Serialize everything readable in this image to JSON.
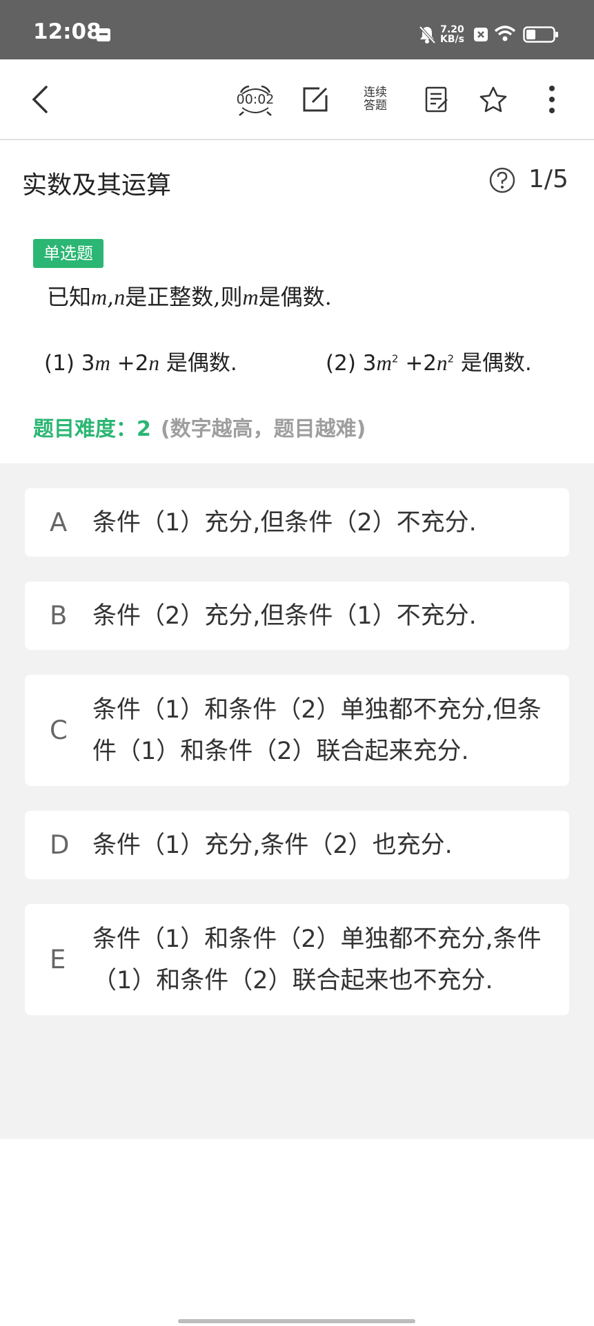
{
  "status_bar": {
    "time": "12:08",
    "net_speed_value": "7.20",
    "net_speed_unit": "KB/s",
    "icons": [
      "calendar-icon",
      "bell-muted-icon",
      "x-box-icon",
      "wifi-icon",
      "battery-icon"
    ]
  },
  "toolbar": {
    "timer": "00:02",
    "continuous_line1": "连续",
    "continuous_line2": "答题",
    "icons": [
      "back-icon",
      "timer-icon",
      "edit-icon",
      "answer-sheet-icon",
      "star-icon",
      "more-icon"
    ]
  },
  "header": {
    "title": "实数及其运算",
    "counter": "1/5"
  },
  "question": {
    "type_badge": "单选题",
    "stem_parts": [
      "已知",
      "m",
      ",",
      "n",
      "是正整数,则",
      "m",
      "是偶数."
    ],
    "condition1": {
      "label": "(1)",
      "coef1": "3",
      "var1": "m",
      "op": "+2",
      "var2": "n",
      "tail": "是偶数."
    },
    "condition2": {
      "label": "(2)",
      "coef1": "3",
      "var1": "m",
      "exp1": "2",
      "op": "+2",
      "var2": "n",
      "exp2": "2",
      "tail": "是偶数."
    },
    "difficulty_label": "题目难度：2",
    "difficulty_hint": "(数字越高，题目越难)"
  },
  "options": [
    {
      "letter": "A",
      "text": "条件（1）充分,但条件（2）不充分."
    },
    {
      "letter": "B",
      "text": "条件（2）充分,但条件（1）不充分."
    },
    {
      "letter": "C",
      "text": "条件（1）和条件（2）单独都不充分,但条件（1）和条件（2）联合起来充分."
    },
    {
      "letter": "D",
      "text": "条件（1）充分,条件（2）也充分."
    },
    {
      "letter": "E",
      "text": "条件（1）和条件（2）单独都不充分,条件（1）和条件（2）联合起来也不充分."
    }
  ],
  "colors": {
    "accent": "#2bb673",
    "status_bar": "#626262",
    "options_bg": "#f2f2f2",
    "hint_gray": "#9e9e9e"
  }
}
